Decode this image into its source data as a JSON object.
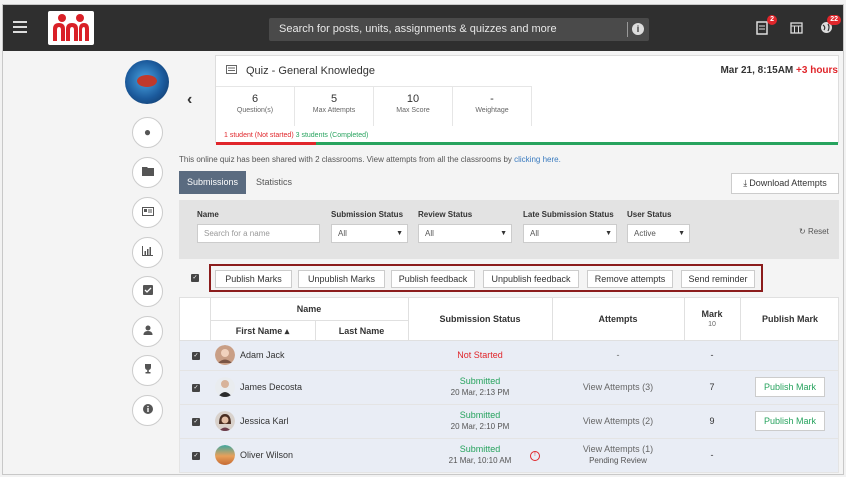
{
  "topbar": {
    "search_placeholder": "Search for posts, units, assignments & quizzes and more",
    "notif_badge_1": "2",
    "notif_badge_2": "22",
    "colors": {
      "bar": "#2f2f2f",
      "badge": "#e0262b",
      "logo": "#d92027"
    }
  },
  "quiz": {
    "title": "Quiz - General Knowledge",
    "date": "Mar 21, 8:15AM",
    "date_extra": "+3 hours",
    "stats": [
      {
        "value": "6",
        "label": "Question(s)"
      },
      {
        "value": "5",
        "label": "Max Attempts"
      },
      {
        "value": "10",
        "label": "Max Score"
      },
      {
        "value": "-",
        "label": "Weightage"
      }
    ],
    "progress_not_started": "1 student (Not started)",
    "progress_completed": "3 students (Completed)",
    "completed_fraction": 0.75
  },
  "share": {
    "text": "This online quiz has been shared with 2 classrooms. View attempts from all the classrooms by",
    "link": "clicking here."
  },
  "tabs": {
    "submissions": "Submissions",
    "statistics": "Statistics"
  },
  "download_label": "Download Attempts",
  "filters": {
    "name_label": "Name",
    "name_placeholder": "Search for a name",
    "submission_label": "Submission Status",
    "submission_value": "All",
    "review_label": "Review Status",
    "review_value": "All",
    "late_label": "Late Submission Status",
    "late_value": "All",
    "user_label": "User Status",
    "user_value": "Active",
    "reset": "Reset"
  },
  "actions": [
    "Publish Marks",
    "Unpublish Marks",
    "Publish feedback",
    "Unpublish feedback",
    "Remove attempts",
    "Send reminder"
  ],
  "table": {
    "name_header": "Name",
    "first_name": "First Name ▴",
    "last_name": "Last Name",
    "submission_status": "Submission Status",
    "attempts": "Attempts",
    "mark": "Mark",
    "mark_max": "10",
    "publish_mark": "Publish Mark",
    "publish_btn": "Publish Mark",
    "rows": [
      {
        "name": "Adam Jack",
        "status": "Not Started",
        "date": "",
        "attempts": "-",
        "attempts_sub": "",
        "mark": "-"
      },
      {
        "name": "James Decosta",
        "status": "Submitted",
        "date": "20 Mar, 2:13 PM",
        "attempts": "View Attempts (3)",
        "attempts_sub": "",
        "mark": "7"
      },
      {
        "name": "Jessica Karl",
        "status": "Submitted",
        "date": "20 Mar, 2:10 PM",
        "attempts": "View Attempts (2)",
        "attempts_sub": "",
        "mark": "9"
      },
      {
        "name": "Oliver Wilson",
        "status": "Submitted",
        "date": "21 Mar, 10:10 AM",
        "attempts": "View Attempts (1)",
        "attempts_sub": "Pending Review",
        "mark": "-"
      }
    ]
  }
}
